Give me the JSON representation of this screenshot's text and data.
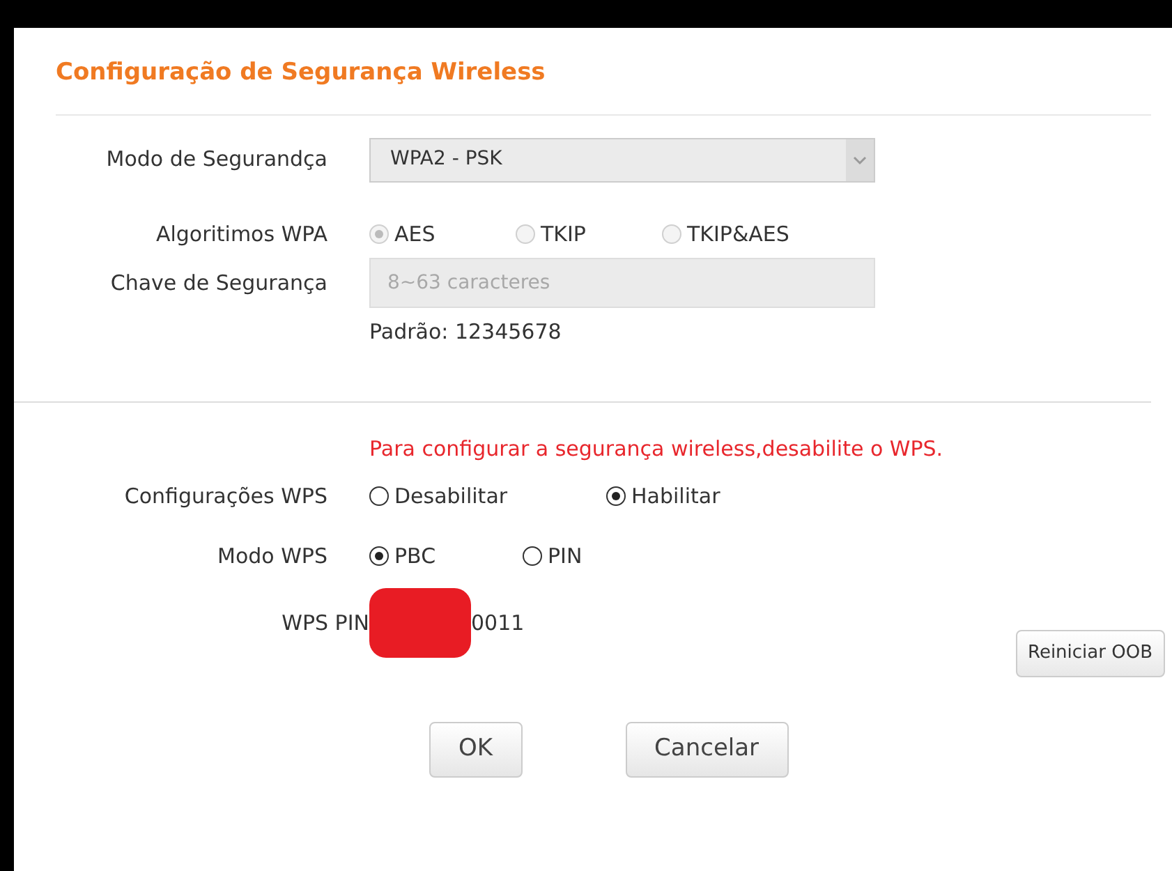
{
  "title": "Configuração de Segurança Wireless",
  "security_mode": {
    "label": "Modo de Segurandça",
    "value": "WPA2 - PSK",
    "disabled": true
  },
  "wpa_algorithm": {
    "label": "Algoritimos WPA",
    "disabled": true,
    "options": [
      {
        "label": "AES",
        "selected": true
      },
      {
        "label": "TKIP",
        "selected": false
      },
      {
        "label": "TKIP&AES",
        "selected": false
      }
    ]
  },
  "security_key": {
    "label": "Chave de Segurança",
    "placeholder": "8~63 caracteres",
    "disabled": true,
    "hint": "Padrão: 12345678"
  },
  "warning": "Para configurar a segurança wireless,desabilite o WPS.",
  "wps_settings": {
    "label": "Configurações WPS",
    "options": [
      {
        "label": "Desabilitar",
        "selected": false
      },
      {
        "label": "Habilitar",
        "selected": true
      }
    ]
  },
  "wps_mode": {
    "label": "Modo WPS",
    "options": [
      {
        "label": "PBC",
        "selected": true
      },
      {
        "label": "PIN",
        "selected": false
      }
    ]
  },
  "wps_pin": {
    "label": "WPS PIN",
    "value": "0011",
    "redacted": true
  },
  "buttons": [
    {
      "label": "Reiniciar OOB",
      "kind": "small"
    },
    {
      "label": "OK",
      "kind": "dialog"
    },
    {
      "label": "Cancelar",
      "kind": "dialog"
    }
  ]
}
